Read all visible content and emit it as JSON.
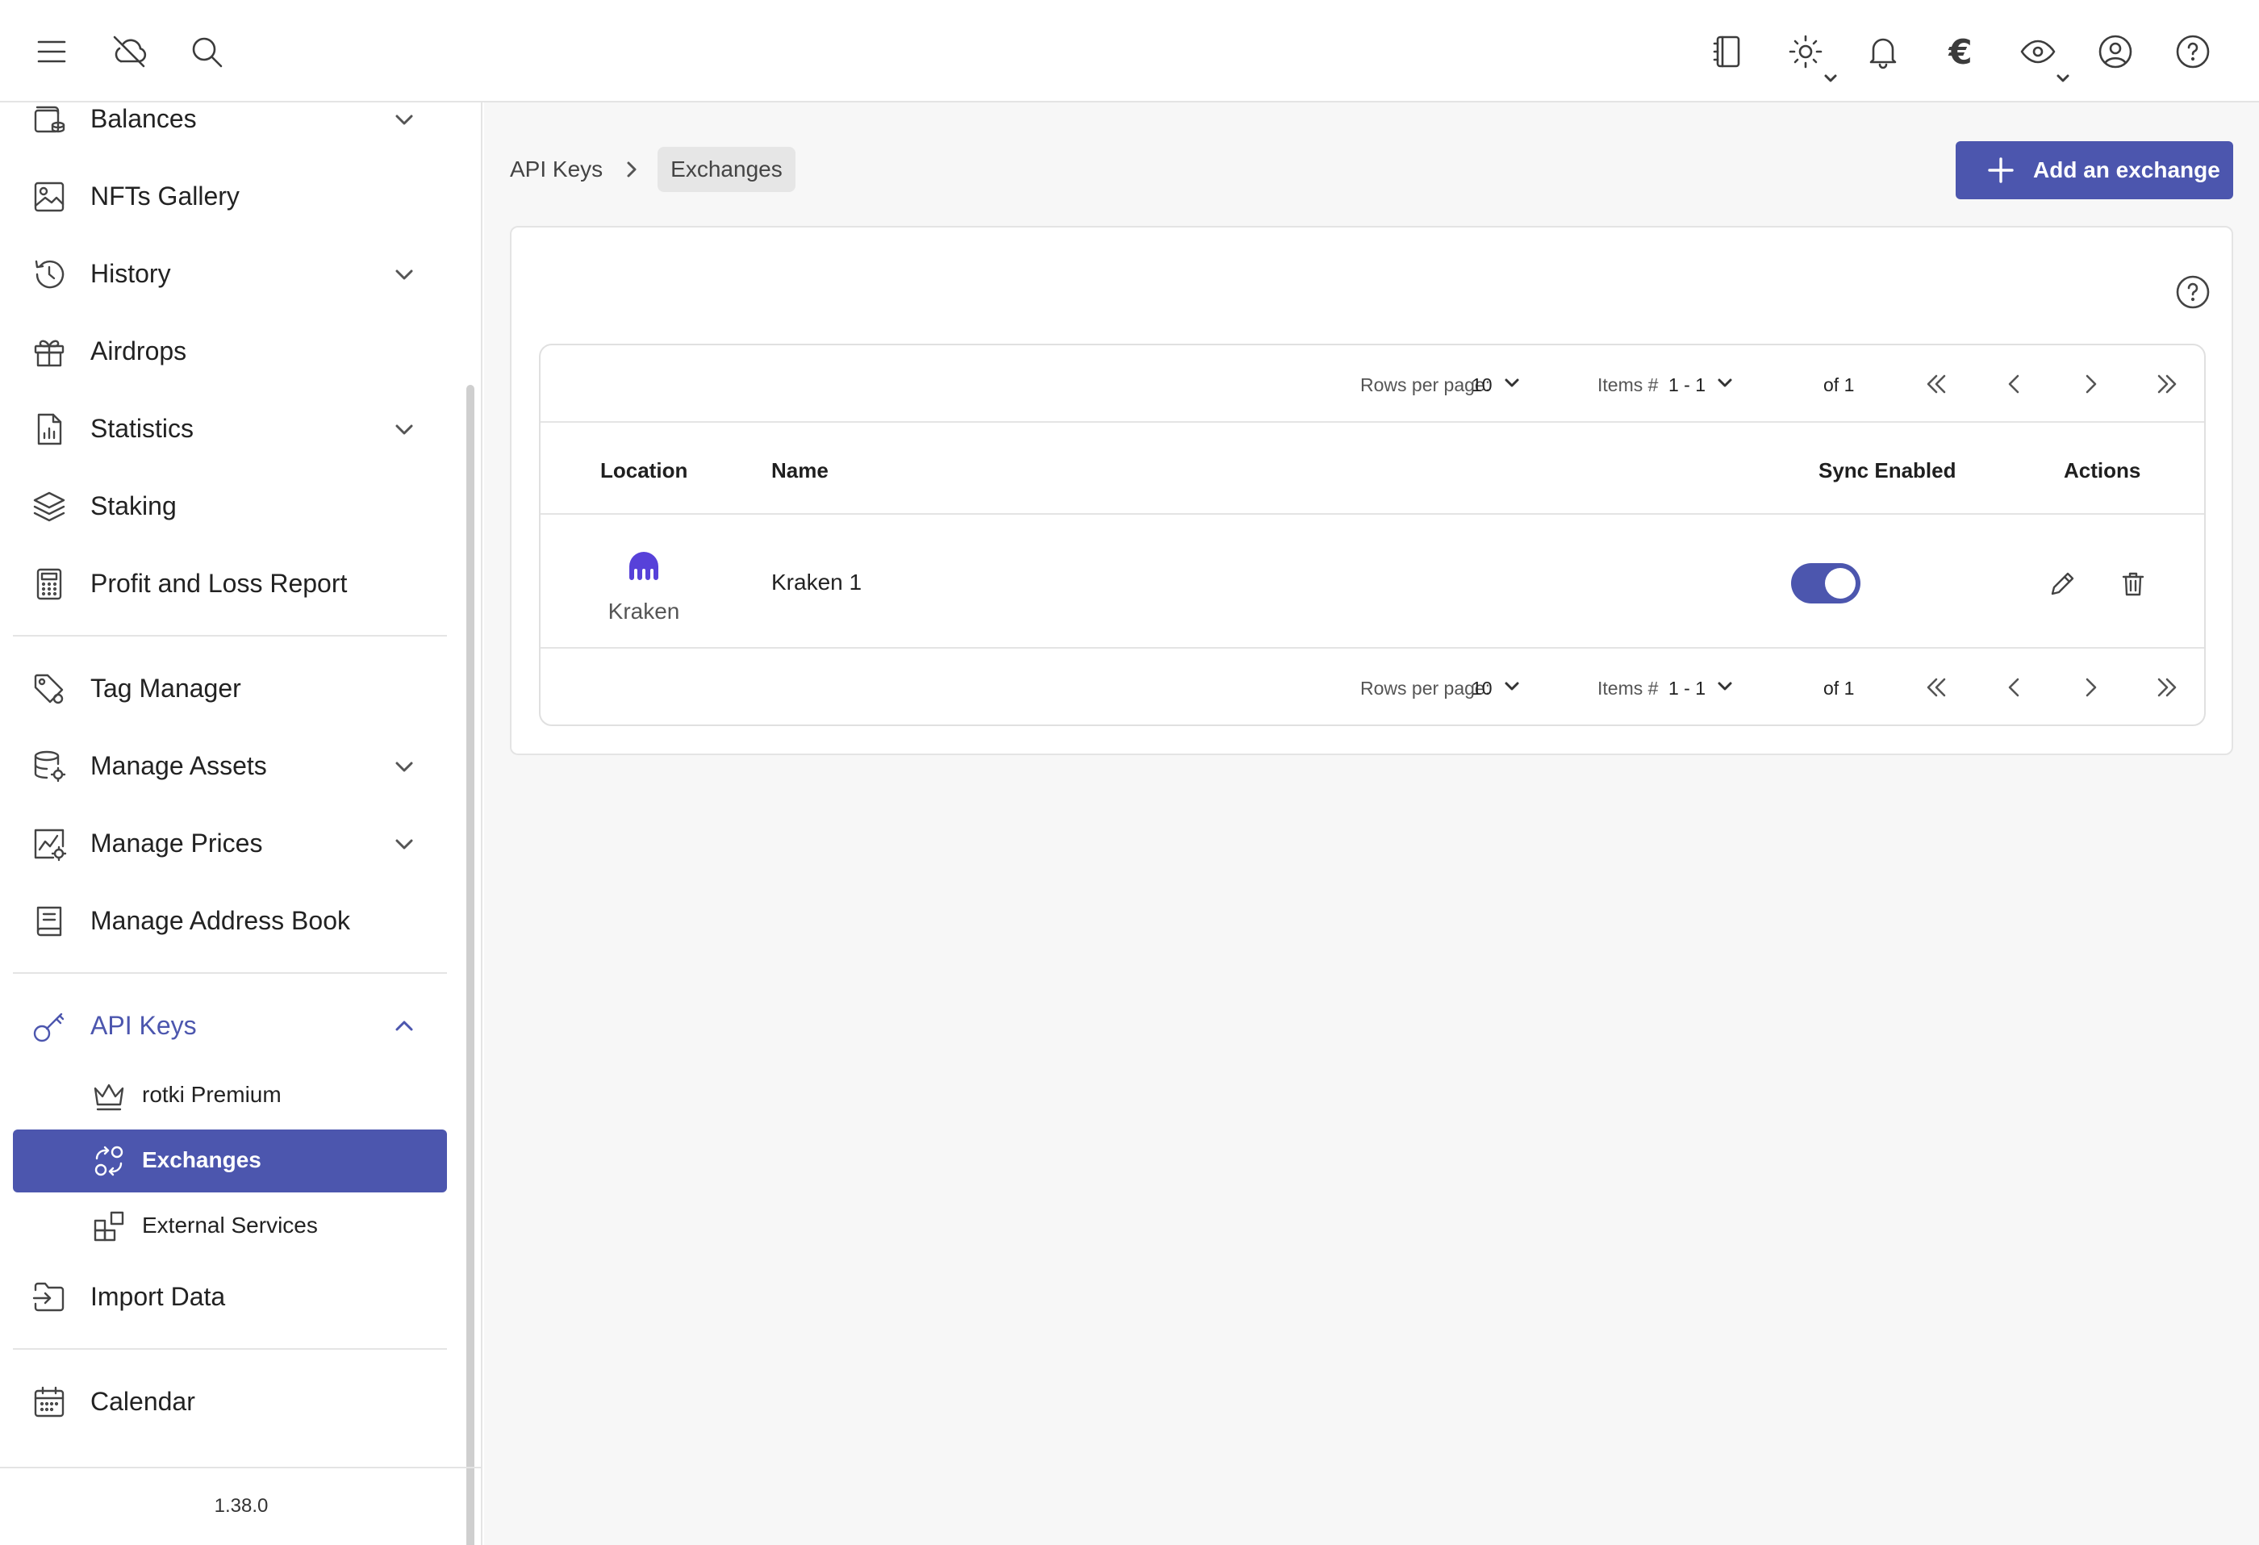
{
  "topbar": {
    "menu_icon": "menu-icon",
    "cloud_icon": "cloud-off-icon",
    "search_icon": "search-icon",
    "notes_icon": "notebook-icon",
    "theme_icon": "sun-icon",
    "notifications_icon": "bell-icon",
    "currency_symbol": "€",
    "privacy_icon": "eye-icon",
    "account_icon": "user-circle-icon",
    "help_icon": "help-circle-icon"
  },
  "sidebar": {
    "items": [
      {
        "label": "Balances",
        "icon": "wallet-icon"
      },
      {
        "label": "NFTs Gallery",
        "icon": "image-icon"
      },
      {
        "label": "History",
        "icon": "history-icon"
      },
      {
        "label": "Airdrops",
        "icon": "gift-icon"
      },
      {
        "label": "Statistics",
        "icon": "chart-file-icon"
      },
      {
        "label": "Staking",
        "icon": "stack-icon"
      },
      {
        "label": "Profit and Loss Report",
        "icon": "calculator-icon"
      },
      {
        "label": "Tag Manager",
        "icon": "tag-icon"
      },
      {
        "label": "Manage Assets",
        "icon": "database-gear-icon"
      },
      {
        "label": "Manage Prices",
        "icon": "price-gear-icon"
      },
      {
        "label": "Manage Address Book",
        "icon": "book-icon"
      },
      {
        "label": "API Keys",
        "icon": "key-icon"
      },
      {
        "label": "Import Data",
        "icon": "import-icon"
      },
      {
        "label": "Calendar",
        "icon": "calendar-icon"
      }
    ],
    "sub_items": [
      {
        "label": "rotki Premium",
        "icon": "crown-icon"
      },
      {
        "label": "Exchanges",
        "icon": "exchange-icon"
      },
      {
        "label": "External Services",
        "icon": "apps-icon"
      }
    ],
    "version": "1.38.0"
  },
  "breadcrumb": {
    "parent": "API Keys",
    "current": "Exchanges"
  },
  "add_button_label": "Add an exchange",
  "pagination": {
    "rows_per_page_label": "Rows per page:",
    "rows_per_page_value": "10",
    "items_label": "Items #",
    "items_value": "1 - 1",
    "of_label": "of 1"
  },
  "table": {
    "headers": {
      "location": "Location",
      "name": "Name",
      "sync": "Sync Enabled",
      "actions": "Actions"
    },
    "rows": [
      {
        "location": "Kraken",
        "name": "Kraken 1",
        "sync_enabled": true
      }
    ]
  },
  "colors": {
    "accent": "#4c56ae",
    "kraken": "#5741d9"
  }
}
